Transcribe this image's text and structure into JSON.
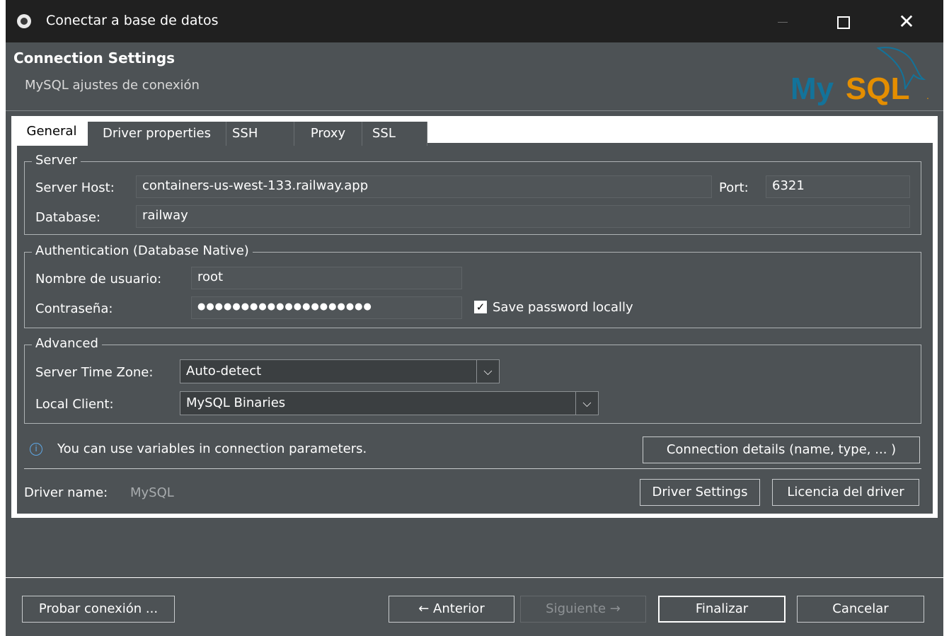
{
  "window": {
    "title": "Conectar a base de datos"
  },
  "header": {
    "title": "Connection Settings",
    "subtitle": "MySQL ajustes de conexión",
    "logo_text": "MySQL"
  },
  "tabs": [
    "General",
    "Driver properties",
    "SSH",
    "Proxy",
    "SSL"
  ],
  "server": {
    "legend": "Server",
    "host_label": "Server Host:",
    "host_value": "containers-us-west-133.railway.app",
    "port_label": "Port:",
    "port_value": "6321",
    "database_label": "Database:",
    "database_value": "railway"
  },
  "auth": {
    "legend": "Authentication (Database Native)",
    "user_label": "Nombre de usuario:",
    "user_value": "root",
    "password_label": "Contraseña:",
    "password_value": "●●●●●●●●●●●●●●●●●●●●",
    "save_password_label": "Save password locally",
    "save_password_checked": true
  },
  "advanced": {
    "legend": "Advanced",
    "timezone_label": "Server Time Zone:",
    "timezone_value": "Auto-detect",
    "client_label": "Local Client:",
    "client_value": "MySQL Binaries"
  },
  "info": {
    "text": "You can use variables in connection parameters.",
    "connection_details_button": "Connection details (name, type, ... )"
  },
  "driver": {
    "label": "Driver name:",
    "value": "MySQL",
    "settings_button": "Driver Settings",
    "license_button": "Licencia del driver"
  },
  "footer": {
    "test_button": "Probar conexión ...",
    "back_button": "← Anterior",
    "next_button": "Siguiente →",
    "finish_button": "Finalizar",
    "cancel_button": "Cancelar"
  },
  "colors": {
    "background": "#4d5255",
    "titlebar": "#202020",
    "logo_blue": "#13739a",
    "logo_orange": "#e48e00",
    "info_blue": "#5fa8e6"
  }
}
